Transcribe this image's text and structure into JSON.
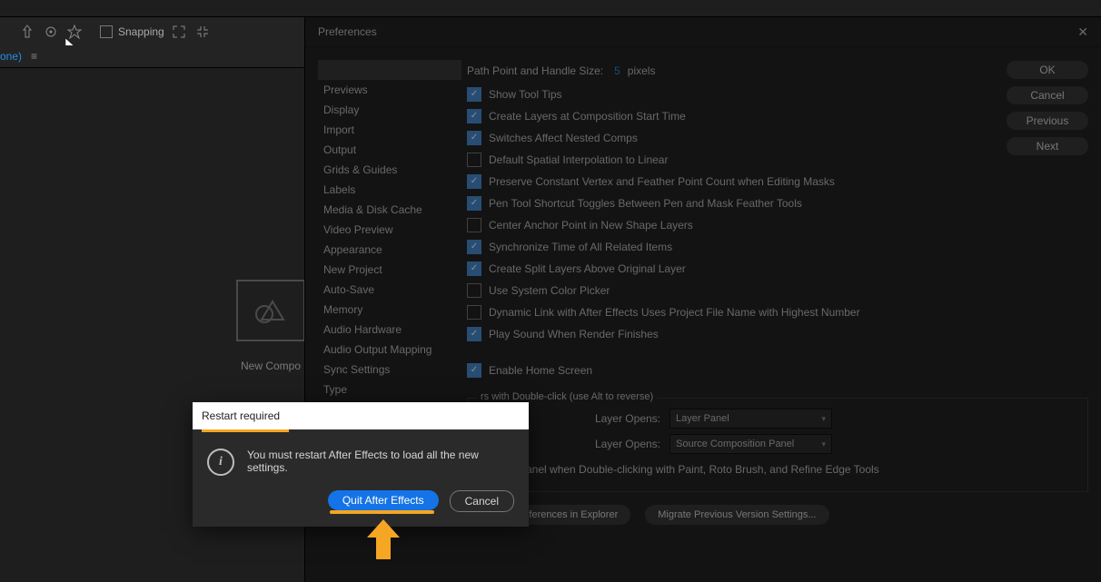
{
  "toolbar": {
    "snapping_label": "Snapping",
    "none_label": "one)"
  },
  "newcomp_label": "New Compo",
  "pref": {
    "title": "Preferences",
    "buttons": {
      "ok": "OK",
      "cancel": "Cancel",
      "previous": "Previous",
      "next": "Next"
    },
    "categories": [
      "",
      "Previews",
      "Display",
      "Import",
      "Output",
      "Grids & Guides",
      "Labels",
      "Media & Disk Cache",
      "Video Preview",
      "Appearance",
      "New Project",
      "Auto-Save",
      "Memory",
      "Audio Hardware",
      "Audio Output Mapping",
      "Sync Settings",
      "Type"
    ],
    "pathpoint_label": "Path Point and Handle Size:",
    "pathpoint_value": "5",
    "pathpoint_unit": "pixels",
    "checks": [
      {
        "on": true,
        "label": "Show Tool Tips"
      },
      {
        "on": true,
        "label": "Create Layers at Composition Start Time"
      },
      {
        "on": true,
        "label": "Switches Affect Nested Comps"
      },
      {
        "on": false,
        "label": "Default Spatial Interpolation to Linear"
      },
      {
        "on": true,
        "label": "Preserve Constant Vertex and Feather Point Count when Editing Masks"
      },
      {
        "on": true,
        "label": "Pen Tool Shortcut Toggles Between Pen and Mask Feather Tools"
      },
      {
        "on": false,
        "label": "Center Anchor Point in New Shape Layers"
      },
      {
        "on": true,
        "label": "Synchronize Time of All Related Items"
      },
      {
        "on": true,
        "label": "Create Split Layers Above Original Layer"
      },
      {
        "on": false,
        "label": "Use System Color Picker"
      },
      {
        "on": false,
        "label": "Dynamic Link with After Effects Uses Project File Name with Highest Number"
      },
      {
        "on": true,
        "label": "Play Sound When Render Finishes"
      }
    ],
    "enable_home": {
      "on": true,
      "label": "Enable Home Screen"
    },
    "fieldset_label": "rs with Double-click (use Alt to reverse)",
    "row1_label": "Layer Opens:",
    "row1_value": "Layer Panel",
    "row2_label": "Layer Opens:",
    "row2_value": "Source Composition Panel",
    "row3": "yer Panel when Double-clicking with Paint, Roto Brush, and Refine Edge Tools",
    "pill1": "Reveal Preferences in Explorer",
    "pill2": "Migrate Previous Version Settings..."
  },
  "modal": {
    "title": "Restart required",
    "message": "You must restart After Effects to load all the new settings.",
    "primary": "Quit After Effects",
    "secondary": "Cancel"
  }
}
